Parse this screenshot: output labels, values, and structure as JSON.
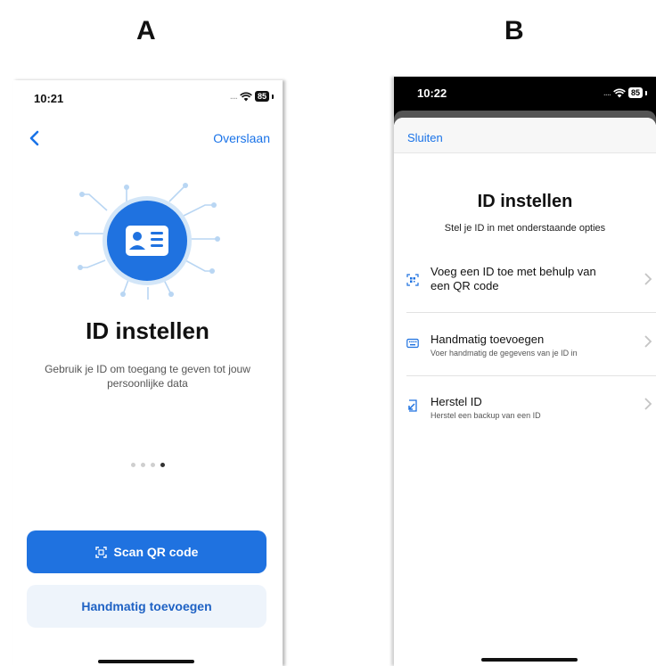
{
  "panel_labels": {
    "a": "A",
    "b": "B"
  },
  "screen_a": {
    "status": {
      "time": "10:21",
      "battery": "85"
    },
    "nav": {
      "skip_label": "Overslaan"
    },
    "title": "ID instellen",
    "description": "Gebruik je ID om toegang te geven tot jouw persoonlijke data",
    "pager": {
      "current_page": 4,
      "total_pages": 4
    },
    "scan_button_label": "Scan QR code",
    "manual_button_label": "Handmatig toevoegen"
  },
  "screen_b": {
    "status": {
      "time": "10:22",
      "battery": "85"
    },
    "close_label": "Sluiten",
    "title": "ID instellen",
    "subtitle": "Stel je ID in met onderstaande opties",
    "options": [
      {
        "title": "Voeg een ID toe met behulp van een QR code",
        "description": "",
        "icon": "qr-code-icon"
      },
      {
        "title": "Handmatig toevoegen",
        "description": "Voer handmatig de gegevens van je ID in",
        "icon": "keyboard-icon"
      },
      {
        "title": "Herstel ID",
        "description": "Herstel een backup van een ID",
        "icon": "restore-icon"
      }
    ]
  },
  "colors": {
    "accent": "#1f72e0",
    "secondary_button_bg": "#eef4fb",
    "secondary_button_text": "#1f62c4"
  }
}
